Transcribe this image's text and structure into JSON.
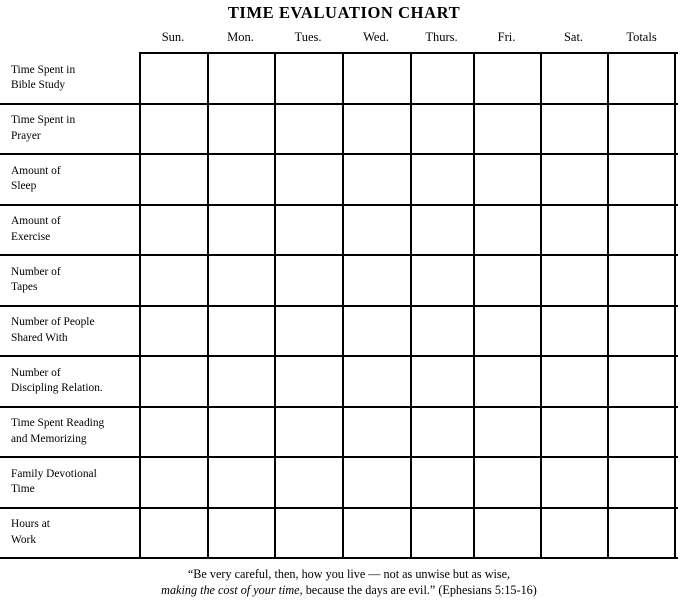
{
  "document": {
    "title": "TIME EVALUATION CHART"
  },
  "table": {
    "column_headers": [
      {
        "label": "Sun."
      },
      {
        "label": "Mon."
      },
      {
        "label": "Tues."
      },
      {
        "label": "Wed."
      },
      {
        "label": "Thurs."
      },
      {
        "label": "Fri."
      },
      {
        "label": "Sat."
      },
      {
        "label": "Totals"
      }
    ],
    "row_label_header": "",
    "rows": [
      {
        "line1": "Time Spent in",
        "line2": "Bible Study",
        "values": [
          "",
          "",
          "",
          "",
          "",
          "",
          "",
          ""
        ]
      },
      {
        "line1": "Time Spent in",
        "line2": "Prayer",
        "values": [
          "",
          "",
          "",
          "",
          "",
          "",
          "",
          ""
        ]
      },
      {
        "line1": "Amount of",
        "line2": "Sleep",
        "values": [
          "",
          "",
          "",
          "",
          "",
          "",
          "",
          ""
        ]
      },
      {
        "line1": "Amount of",
        "line2": "Exercise",
        "values": [
          "",
          "",
          "",
          "",
          "",
          "",
          "",
          ""
        ]
      },
      {
        "line1": "Number of",
        "line2": "Tapes",
        "values": [
          "",
          "",
          "",
          "",
          "",
          "",
          "",
          ""
        ]
      },
      {
        "line1": "Number of People",
        "line2": "Shared With",
        "values": [
          "",
          "",
          "",
          "",
          "",
          "",
          "",
          ""
        ]
      },
      {
        "line1": "Number of",
        "line2": "Discipling Relation.",
        "values": [
          "",
          "",
          "",
          "",
          "",
          "",
          "",
          ""
        ]
      },
      {
        "line1": "Time Spent Reading",
        "line2": "and Memorizing",
        "values": [
          "",
          "",
          "",
          "",
          "",
          "",
          "",
          ""
        ]
      },
      {
        "line1": "Family Devotional",
        "line2": "Time",
        "values": [
          "",
          "",
          "",
          "",
          "",
          "",
          "",
          ""
        ]
      },
      {
        "line1": "Hours at",
        "line2": "Work",
        "values": [
          "",
          "",
          "",
          "",
          "",
          "",
          "",
          ""
        ]
      }
    ]
  },
  "footer": {
    "line1": "“Be very careful, then, how you live — not as unwise but as wise,",
    "line2_italic": "making the cost of your time",
    "line2_rest": ", because the days are evil.” (Ephesians 5:15-16)"
  },
  "colors": {
    "ink": "#000000",
    "paper": "#ffffff"
  },
  "layout": {
    "column_x": [
      139,
      207,
      274,
      342,
      410,
      473,
      540,
      607,
      676
    ]
  }
}
